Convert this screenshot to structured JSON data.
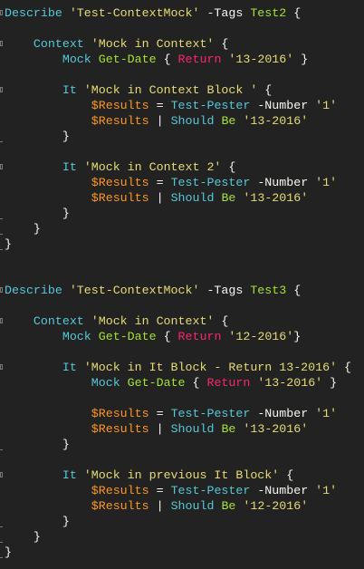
{
  "colors": {
    "background": "#222222",
    "keyword": "#56c8d8",
    "string": "#e6db74",
    "command": "#a6e22e",
    "return": "#f92672",
    "variable": "#fd971f",
    "text": "#f8f8f2"
  },
  "lines": [
    {
      "fold": true,
      "t": [
        [
          "kw",
          "Describe"
        ],
        [
          "txt",
          " "
        ],
        [
          "str",
          "'Test-ContextMock'"
        ],
        [
          "txt",
          " -Tags "
        ],
        [
          "grn",
          "Test2"
        ],
        [
          "txt",
          " {"
        ]
      ]
    },
    {
      "t": []
    },
    {
      "fold": true,
      "t": [
        [
          "txt",
          "    "
        ],
        [
          "kw",
          "Context"
        ],
        [
          "txt",
          " "
        ],
        [
          "str",
          "'Mock in Context'"
        ],
        [
          "txt",
          " {"
        ]
      ]
    },
    {
      "t": [
        [
          "txt",
          "        "
        ],
        [
          "kw",
          "Mock"
        ],
        [
          "txt",
          " "
        ],
        [
          "grn",
          "Get-Date"
        ],
        [
          "txt",
          " { "
        ],
        [
          "red",
          "Return"
        ],
        [
          "txt",
          " "
        ],
        [
          "str",
          "'13-2016'"
        ],
        [
          "txt",
          " }"
        ]
      ]
    },
    {
      "t": []
    },
    {
      "fold": true,
      "t": [
        [
          "txt",
          "        "
        ],
        [
          "kw",
          "It"
        ],
        [
          "txt",
          " "
        ],
        [
          "str",
          "'Mock in Context Block '"
        ],
        [
          "txt",
          " {"
        ]
      ]
    },
    {
      "t": [
        [
          "txt",
          "            "
        ],
        [
          "var",
          "$Results"
        ],
        [
          "txt",
          " = "
        ],
        [
          "kw",
          "Test-Pester"
        ],
        [
          "txt",
          " -Number "
        ],
        [
          "str",
          "'1'"
        ]
      ]
    },
    {
      "t": [
        [
          "txt",
          "            "
        ],
        [
          "var",
          "$Results"
        ],
        [
          "txt",
          " | "
        ],
        [
          "kw",
          "Should"
        ],
        [
          "txt",
          " "
        ],
        [
          "grn",
          "Be"
        ],
        [
          "txt",
          " "
        ],
        [
          "str",
          "'13-2016'"
        ]
      ]
    },
    {
      "end": true,
      "t": [
        [
          "txt",
          "        }"
        ]
      ]
    },
    {
      "t": []
    },
    {
      "fold": true,
      "t": [
        [
          "txt",
          "        "
        ],
        [
          "kw",
          "It"
        ],
        [
          "txt",
          " "
        ],
        [
          "str",
          "'Mock in Context 2'"
        ],
        [
          "txt",
          " {"
        ]
      ]
    },
    {
      "t": [
        [
          "txt",
          "            "
        ],
        [
          "var",
          "$Results"
        ],
        [
          "txt",
          " = "
        ],
        [
          "kw",
          "Test-Pester"
        ],
        [
          "txt",
          " -Number "
        ],
        [
          "str",
          "'1'"
        ]
      ]
    },
    {
      "t": [
        [
          "txt",
          "            "
        ],
        [
          "var",
          "$Results"
        ],
        [
          "txt",
          " | "
        ],
        [
          "kw",
          "Should"
        ],
        [
          "txt",
          " "
        ],
        [
          "grn",
          "Be"
        ],
        [
          "txt",
          " "
        ],
        [
          "str",
          "'13-2016'"
        ]
      ]
    },
    {
      "end": true,
      "t": [
        [
          "txt",
          "        }"
        ]
      ]
    },
    {
      "end": true,
      "t": [
        [
          "txt",
          "    }"
        ]
      ]
    },
    {
      "end": true,
      "t": [
        [
          "txt",
          "}"
        ]
      ]
    },
    {
      "t": []
    },
    {
      "t": []
    },
    {
      "fold": true,
      "t": [
        [
          "kw",
          "Describe"
        ],
        [
          "txt",
          " "
        ],
        [
          "str",
          "'Test-ContextMock'"
        ],
        [
          "txt",
          " -Tags "
        ],
        [
          "grn",
          "Test3"
        ],
        [
          "txt",
          " {"
        ]
      ]
    },
    {
      "t": []
    },
    {
      "fold": true,
      "t": [
        [
          "txt",
          "    "
        ],
        [
          "kw",
          "Context"
        ],
        [
          "txt",
          " "
        ],
        [
          "str",
          "'Mock in Context'"
        ],
        [
          "txt",
          " {"
        ]
      ]
    },
    {
      "t": [
        [
          "txt",
          "        "
        ],
        [
          "kw",
          "Mock"
        ],
        [
          "txt",
          " "
        ],
        [
          "grn",
          "Get-Date"
        ],
        [
          "txt",
          " { "
        ],
        [
          "red",
          "Return"
        ],
        [
          "txt",
          " "
        ],
        [
          "str",
          "'12-2016'"
        ],
        [
          "txt",
          "}"
        ]
      ]
    },
    {
      "t": []
    },
    {
      "fold": true,
      "t": [
        [
          "txt",
          "        "
        ],
        [
          "kw",
          "It"
        ],
        [
          "txt",
          " "
        ],
        [
          "str",
          "'Mock in It Block - Return 13-2016'"
        ],
        [
          "txt",
          " {"
        ]
      ]
    },
    {
      "t": [
        [
          "txt",
          "            "
        ],
        [
          "kw",
          "Mock"
        ],
        [
          "txt",
          " "
        ],
        [
          "grn",
          "Get-Date"
        ],
        [
          "txt",
          " { "
        ],
        [
          "red",
          "Return"
        ],
        [
          "txt",
          " "
        ],
        [
          "str",
          "'13-2016'"
        ],
        [
          "txt",
          " }"
        ]
      ]
    },
    {
      "t": []
    },
    {
      "t": [
        [
          "txt",
          "            "
        ],
        [
          "var",
          "$Results"
        ],
        [
          "txt",
          " = "
        ],
        [
          "kw",
          "Test-Pester"
        ],
        [
          "txt",
          " -Number "
        ],
        [
          "str",
          "'1'"
        ]
      ]
    },
    {
      "t": [
        [
          "txt",
          "            "
        ],
        [
          "var",
          "$Results"
        ],
        [
          "txt",
          " | "
        ],
        [
          "kw",
          "Should"
        ],
        [
          "txt",
          " "
        ],
        [
          "grn",
          "Be"
        ],
        [
          "txt",
          " "
        ],
        [
          "str",
          "'13-2016'"
        ]
      ]
    },
    {
      "end": true,
      "t": [
        [
          "txt",
          "        }"
        ]
      ]
    },
    {
      "t": []
    },
    {
      "fold": true,
      "t": [
        [
          "txt",
          "        "
        ],
        [
          "kw",
          "It"
        ],
        [
          "txt",
          " "
        ],
        [
          "str",
          "'Mock in previous It Block'"
        ],
        [
          "txt",
          " {"
        ]
      ]
    },
    {
      "t": [
        [
          "txt",
          "            "
        ],
        [
          "var",
          "$Results"
        ],
        [
          "txt",
          " = "
        ],
        [
          "kw",
          "Test-Pester"
        ],
        [
          "txt",
          " -Number "
        ],
        [
          "str",
          "'1'"
        ]
      ]
    },
    {
      "t": [
        [
          "txt",
          "            "
        ],
        [
          "var",
          "$Results"
        ],
        [
          "txt",
          " | "
        ],
        [
          "kw",
          "Should"
        ],
        [
          "txt",
          " "
        ],
        [
          "grn",
          "Be"
        ],
        [
          "txt",
          " "
        ],
        [
          "str",
          "'12-2016'"
        ]
      ]
    },
    {
      "end": true,
      "t": [
        [
          "txt",
          "        }"
        ]
      ]
    },
    {
      "end": true,
      "t": [
        [
          "txt",
          "    }"
        ]
      ]
    },
    {
      "end": true,
      "t": [
        [
          "txt",
          "}"
        ]
      ]
    }
  ]
}
